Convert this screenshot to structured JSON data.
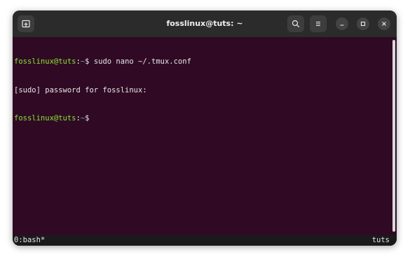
{
  "window": {
    "title": "fosslinux@tuts: ~"
  },
  "icons": {
    "new_tab": "new-tab-icon",
    "search": "search-icon",
    "menu": "hamburger-menu-icon",
    "minimize": "minimize-icon",
    "maximize": "maximize-icon",
    "close": "close-icon"
  },
  "terminal": {
    "lines": [
      {
        "user": "fosslinux@tuts",
        "sep": ":",
        "path": "~",
        "symbol": "$",
        "command": " sudo nano ~/.tmux.conf"
      },
      {
        "text": "[sudo] password for fosslinux:"
      },
      {
        "user": "fosslinux@tuts",
        "sep": ":",
        "path": "~",
        "symbol": "$",
        "command": ""
      }
    ]
  },
  "statusbar": {
    "left": "0:bash*",
    "right": "tuts"
  },
  "colors": {
    "terminal_bg": "#300a24",
    "titlebar_bg": "#2b2b2b",
    "prompt_user": "#8ae234",
    "prompt_path": "#729fcf",
    "statusbar_bg": "#1a1a1a"
  }
}
